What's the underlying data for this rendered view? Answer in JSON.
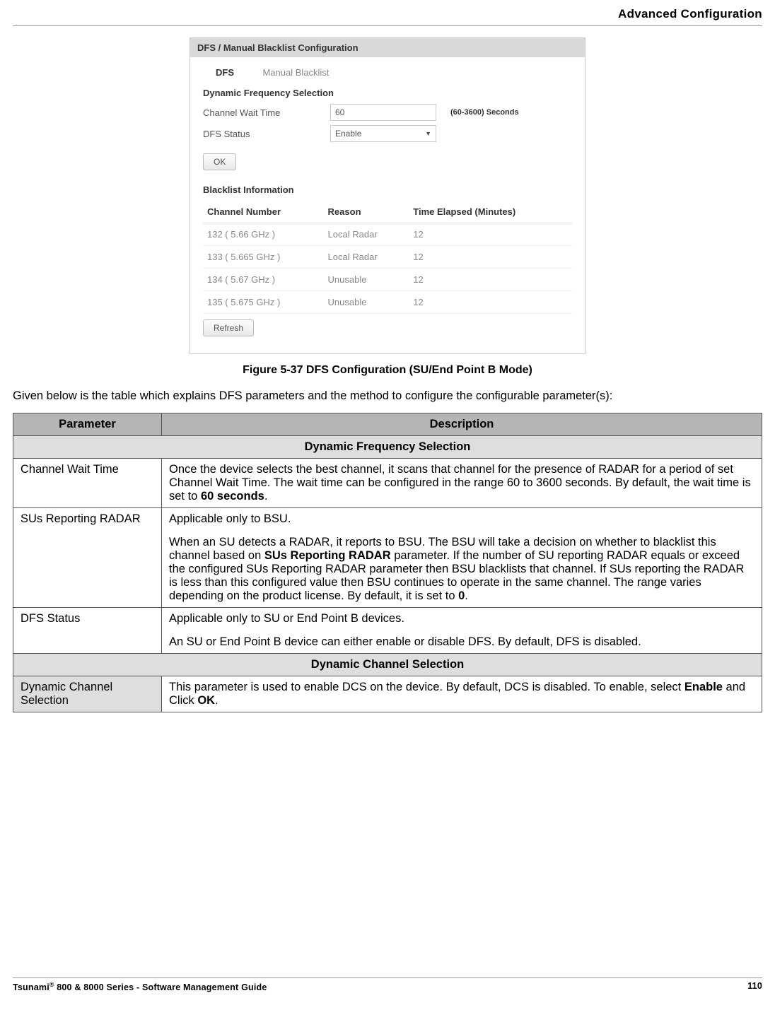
{
  "header": {
    "title": "Advanced Configuration"
  },
  "screenshot": {
    "panel_title": "DFS / Manual Blacklist Configuration",
    "tabs": {
      "active": "DFS",
      "inactive": "Manual Blacklist"
    },
    "dfs_heading": "Dynamic Frequency Selection",
    "row1": {
      "label": "Channel Wait Time",
      "value": "60",
      "hint": "(60-3600) Seconds"
    },
    "row2": {
      "label": "DFS Status",
      "value": "Enable"
    },
    "ok_label": "OK",
    "blacklist_heading": "Blacklist Information",
    "headers": {
      "c1": "Channel Number",
      "c2": "Reason",
      "c3": "Time Elapsed (Minutes)"
    },
    "rows": [
      {
        "ch": "132  ( 5.66 GHz )",
        "reason": "Local Radar",
        "time": "12"
      },
      {
        "ch": "133  ( 5.665 GHz )",
        "reason": "Local Radar",
        "time": "12"
      },
      {
        "ch": "134  ( 5.67 GHz )",
        "reason": "Unusable",
        "time": "12"
      },
      {
        "ch": "135  ( 5.675 GHz )",
        "reason": "Unusable",
        "time": "12"
      }
    ],
    "refresh_label": "Refresh"
  },
  "figure_caption": "Figure 5-37 DFS Configuration (SU/End Point B Mode)",
  "intro_text": "Given below is the table which explains DFS parameters and the method to configure the configurable parameter(s):",
  "params_table": {
    "headers": {
      "c1": "Parameter",
      "c2": "Description"
    },
    "sub1": "Dynamic Frequency Selection",
    "r1": {
      "p": "Channel Wait Time",
      "d1": "Once the device selects the best channel, it scans that channel for the presence of RADAR for a period of set Channel Wait Time. The wait time can be configured in the range 60 to 3600 seconds. By default, the wait time is set to ",
      "d2": "60 seconds",
      "d3": "."
    },
    "r2": {
      "p": "SUs Reporting RADAR",
      "d1": "Applicable only to BSU.",
      "d2a": "When an SU detects a RADAR, it reports to BSU. The BSU will take a decision on whether to blacklist this channel based on ",
      "d2b": "SUs Reporting RADAR",
      "d2c": " parameter. If the number of SU reporting RADAR equals or exceed the configured SUs Reporting RADAR parameter then BSU blacklists that channel. If SUs reporting the RADAR is less than this configured value then BSU continues to operate in the same channel. The range varies depending on the product license. By default, it is set to ",
      "d2d": "0",
      "d2e": "."
    },
    "r3": {
      "p": "DFS Status",
      "d1": "Applicable only to SU or End Point B devices.",
      "d2": "An SU or End Point B device can either enable or disable DFS. By default, DFS is disabled."
    },
    "sub2": "Dynamic Channel Selection",
    "r4": {
      "p": "Dynamic Channel Selection",
      "d1": "This parameter is used to enable DCS on the device. By default, DCS is disabled. To enable, select ",
      "d2": "Enable",
      "d3": " and Click ",
      "d4": "OK",
      "d5": "."
    }
  },
  "footer": {
    "left_a": "Tsunami",
    "left_sup": "®",
    "left_b": " 800 & 8000 Series - Software Management Guide",
    "page": "110"
  }
}
